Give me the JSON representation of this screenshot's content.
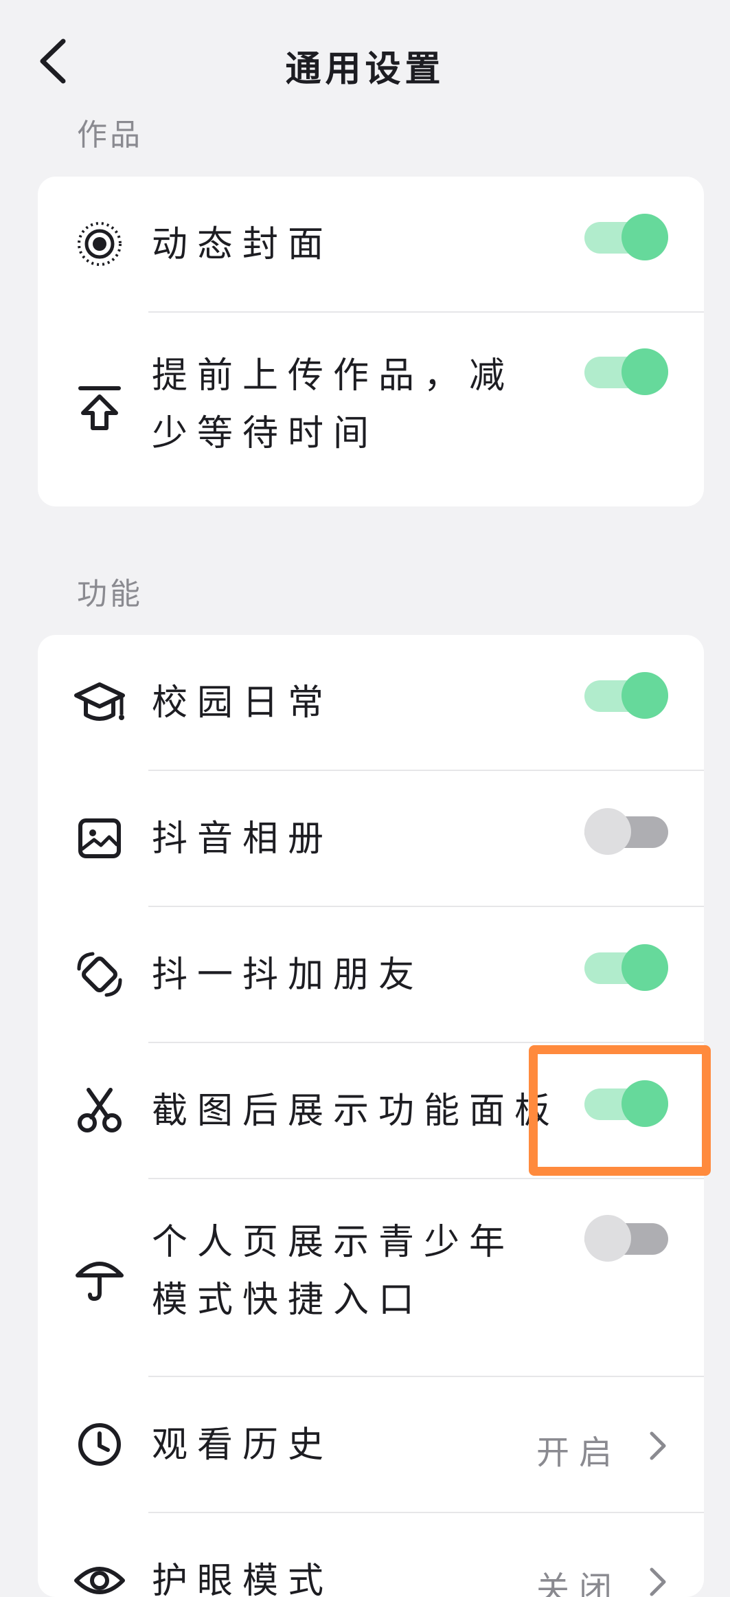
{
  "header": {
    "title": "通用设置"
  },
  "sections": [
    {
      "label": "作品",
      "items": [
        {
          "icon": "live-cover-icon",
          "label": "动态封面",
          "toggle": true
        },
        {
          "icon": "upload-icon",
          "label": "提前上传作品，减少等待时间",
          "toggle": true
        }
      ]
    },
    {
      "label": "功能",
      "items": [
        {
          "icon": "graduation-cap-icon",
          "label": "校园日常",
          "toggle": true
        },
        {
          "icon": "image-icon",
          "label": "抖音相册",
          "toggle": false
        },
        {
          "icon": "shake-phone-icon",
          "label": "抖一抖加朋友",
          "toggle": true
        },
        {
          "icon": "scissors-icon",
          "label": "截图后展示功能面板",
          "toggle": true
        },
        {
          "icon": "umbrella-icon",
          "label": "个人页展示青少年模式快捷入口",
          "toggle": false
        },
        {
          "icon": "clock-icon",
          "label": "观看历史",
          "value": "开启"
        },
        {
          "icon": "eye-icon",
          "label": "护眼模式",
          "value": "关闭"
        }
      ]
    }
  ],
  "colors": {
    "toggle_on": "#66d99b",
    "toggle_on_track": "#b1eccc",
    "toggle_off": "#aeaeb2",
    "highlight": "#ff8a3d"
  }
}
